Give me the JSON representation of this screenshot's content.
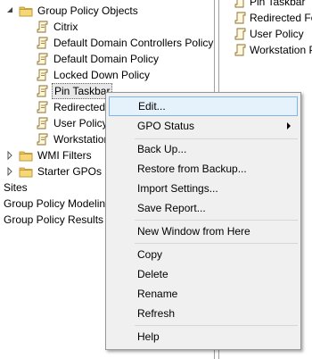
{
  "tree": {
    "root_label": "Group Policy Objects",
    "gpos": [
      "Citrix",
      "Default Domain Controllers Policy",
      "Default Domain Policy",
      "Locked Down Policy",
      "Pin Taskbar",
      "Redirected",
      "User Policy",
      "Workstation"
    ],
    "wmi_filters": "WMI Filters",
    "starter_gpos": "Starter GPOs",
    "sites": "Sites",
    "modeling": "Group Policy Modeling",
    "results": "Group Policy Results"
  },
  "right_pane": {
    "items": [
      "Pin Taskbar",
      "Redirected Fold",
      "User Policy",
      "Workstation Po"
    ]
  },
  "context_menu": {
    "edit": "Edit...",
    "gpo_status": "GPO Status",
    "back_up": "Back Up...",
    "restore": "Restore from Backup...",
    "import": "Import Settings...",
    "save_report": "Save Report...",
    "new_window": "New Window from Here",
    "copy": "Copy",
    "delete": "Delete",
    "rename": "Rename",
    "refresh": "Refresh",
    "help": "Help"
  }
}
